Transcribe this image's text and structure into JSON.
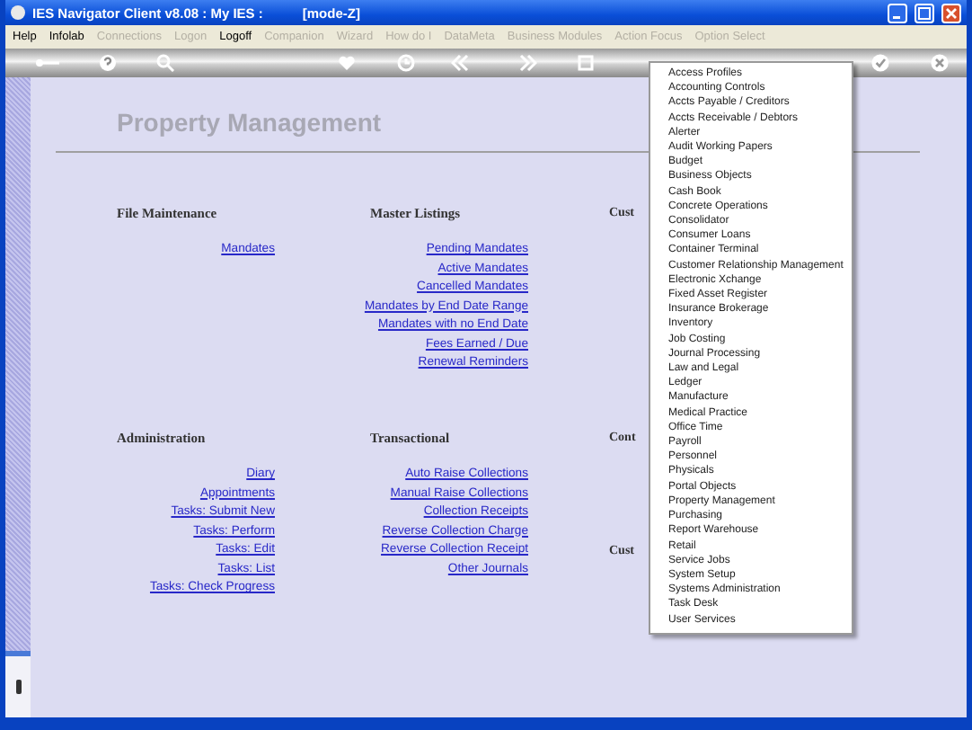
{
  "window": {
    "title": "IES Navigator Client v8.08 : My IES :",
    "mode": "[mode-Z]"
  },
  "menu_bar": [
    {
      "label": "Help",
      "disabled": false
    },
    {
      "label": "Infolab",
      "disabled": false
    },
    {
      "label": "Connections",
      "disabled": true
    },
    {
      "label": "Logon",
      "disabled": true
    },
    {
      "label": "Logoff",
      "disabled": false
    },
    {
      "label": "Companion",
      "disabled": true
    },
    {
      "label": "Wizard",
      "disabled": true
    },
    {
      "label": "How do I",
      "disabled": true
    },
    {
      "label": "DataMeta",
      "disabled": true
    },
    {
      "label": "Business Modules",
      "disabled": true
    },
    {
      "label": "Action Focus",
      "disabled": true
    },
    {
      "label": "Option Select",
      "disabled": true
    }
  ],
  "page": {
    "heading": "Property Management",
    "rows": [
      {
        "sections": [
          {
            "headings": [
              "File Maintenance"
            ],
            "links": [
              "Mandates"
            ]
          },
          {
            "headings": [
              "Master Listings"
            ],
            "links": [
              "Pending Mandates",
              "Active Mandates",
              "Cancelled Mandates",
              "Mandates by End Date Range",
              "Mandates with no End Date",
              "Fees Earned / Due",
              "Renewal Reminders"
            ]
          },
          {
            "headings": [
              "Cust"
            ]
          }
        ]
      },
      {
        "sections": [
          {
            "headings": [
              "Administration"
            ],
            "links": [
              "Diary",
              "Appointments",
              "Tasks: Submit New",
              "Tasks: Perform",
              "Tasks: Edit",
              "Tasks: List",
              "Tasks: Check Progress"
            ]
          },
          {
            "headings": [
              "Transactional"
            ],
            "links": [
              "Auto Raise Collections",
              "Manual Raise Collections",
              "Collection Receipts",
              "Reverse Collection Charge",
              "Reverse Collection Receipt",
              "Other Journals"
            ]
          },
          {
            "headings": [
              "Cont",
              "Cust"
            ]
          }
        ]
      }
    ]
  },
  "dropdown": {
    "items": [
      "Access Profiles",
      "Accounting Controls",
      "Accts Payable / Creditors",
      "Accts Receivable / Debtors",
      "Alerter",
      "Audit Working Papers",
      "Budget",
      "Business Objects",
      "Cash Book",
      "Concrete Operations",
      "Consolidator",
      "Consumer Loans",
      "Container Terminal",
      "Customer Relationship Management",
      "Electronic Xchange",
      "Fixed Asset Register",
      "Insurance Brokerage",
      "Inventory",
      "Job Costing",
      "Journal Processing",
      "Law and Legal",
      "Ledger",
      "Manufacture",
      "Medical Practice",
      "Office Time",
      "Payroll",
      "Personnel",
      "Physicals",
      "Portal Objects",
      "Property Management",
      "Purchasing",
      "Report Warehouse",
      "Retail",
      "Service Jobs",
      "System Setup",
      "Systems Administration",
      "Task Desk",
      "User Services"
    ]
  }
}
